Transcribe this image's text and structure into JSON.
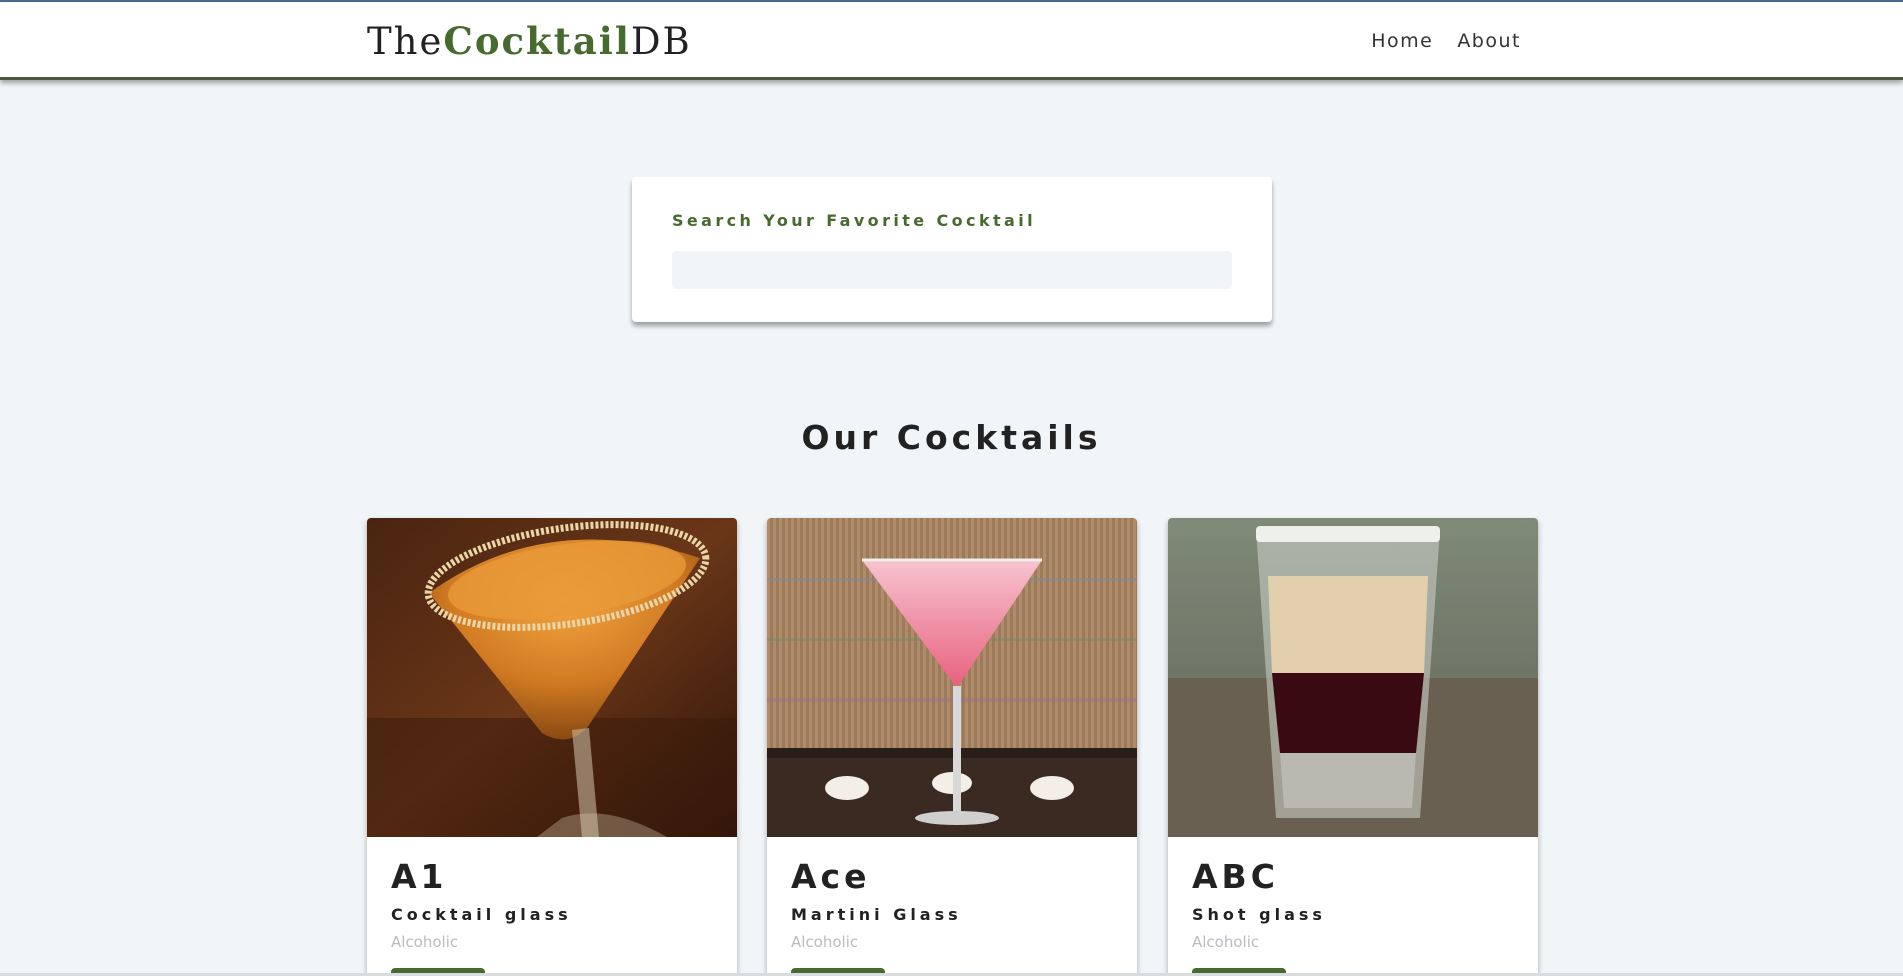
{
  "brand": {
    "prefix": "The",
    "highlight": "Cocktail",
    "suffix": "DB",
    "accent_color": "#476a2e"
  },
  "nav": {
    "links": [
      {
        "label": "Home"
      },
      {
        "label": "About"
      }
    ]
  },
  "search": {
    "label": "Search Your Favorite Cocktail",
    "value": "",
    "placeholder": ""
  },
  "section": {
    "title": "Our Cocktails"
  },
  "cocktails": [
    {
      "name": "A1",
      "glass": "Cocktail glass",
      "info": "Alcoholic",
      "image_icon": "orange-cocktail-glass-photo"
    },
    {
      "name": "Ace",
      "glass": "Martini Glass",
      "info": "Alcoholic",
      "image_icon": "pink-martini-photo"
    },
    {
      "name": "ABC",
      "glass": "Shot glass",
      "info": "Alcoholic",
      "image_icon": "layered-shot-glass-photo"
    }
  ],
  "colors": {
    "page_background": "#f1f5f8",
    "primary": "#476a2e",
    "muted_text": "#b8bcc0"
  }
}
